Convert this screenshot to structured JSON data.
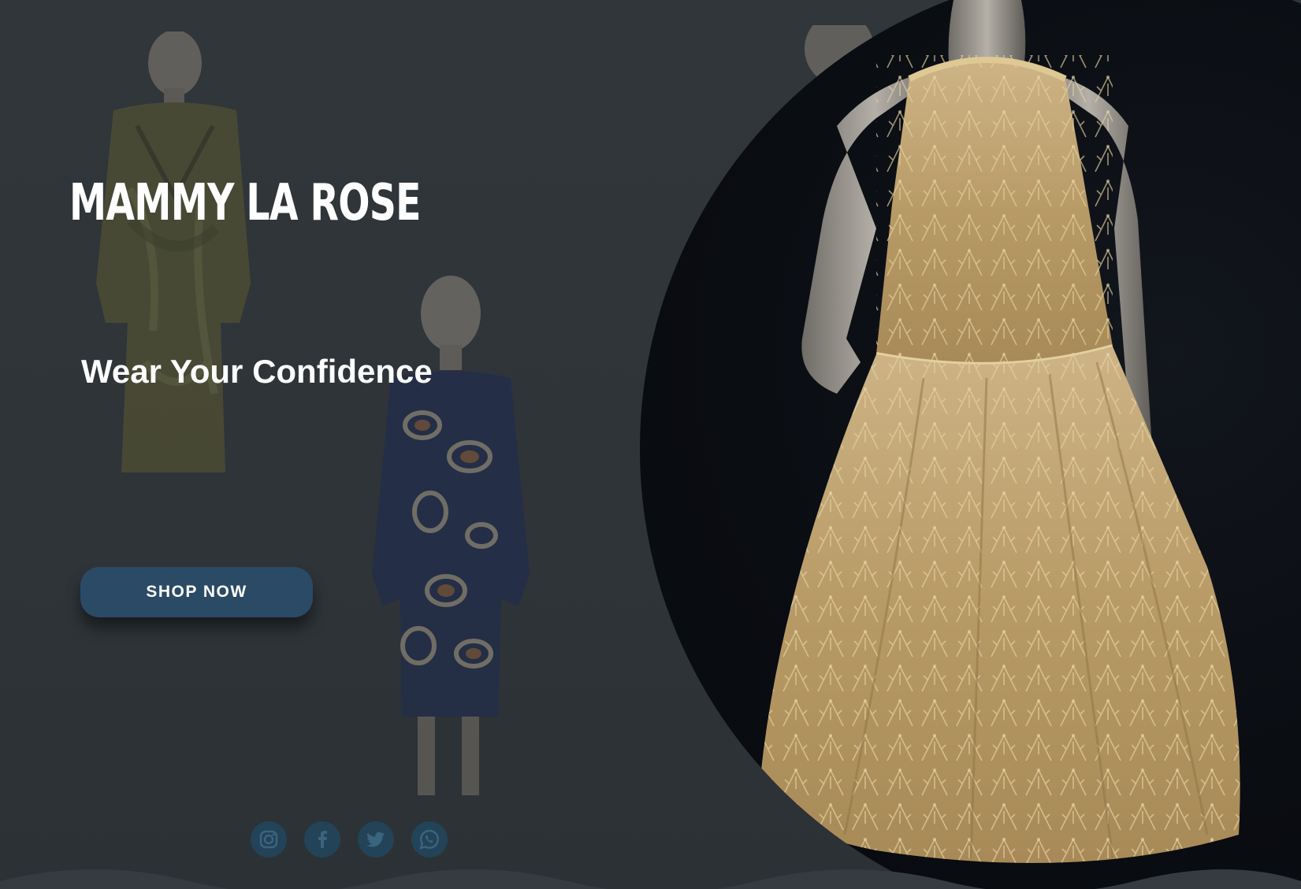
{
  "brand": {
    "title": "MAMMY LA ROSE"
  },
  "hero": {
    "tagline": "Wear Your Confidence",
    "cta_label": "SHOP NOW"
  },
  "social": [
    {
      "name": "instagram-icon"
    },
    {
      "name": "facebook-icon"
    },
    {
      "name": "twitter-icon"
    },
    {
      "name": "whatsapp-icon"
    }
  ],
  "colors": {
    "background": "#30363a",
    "button": "#2a4a66",
    "social": "#23455c",
    "text": "#ffffff",
    "gold": "#c9ad78"
  }
}
